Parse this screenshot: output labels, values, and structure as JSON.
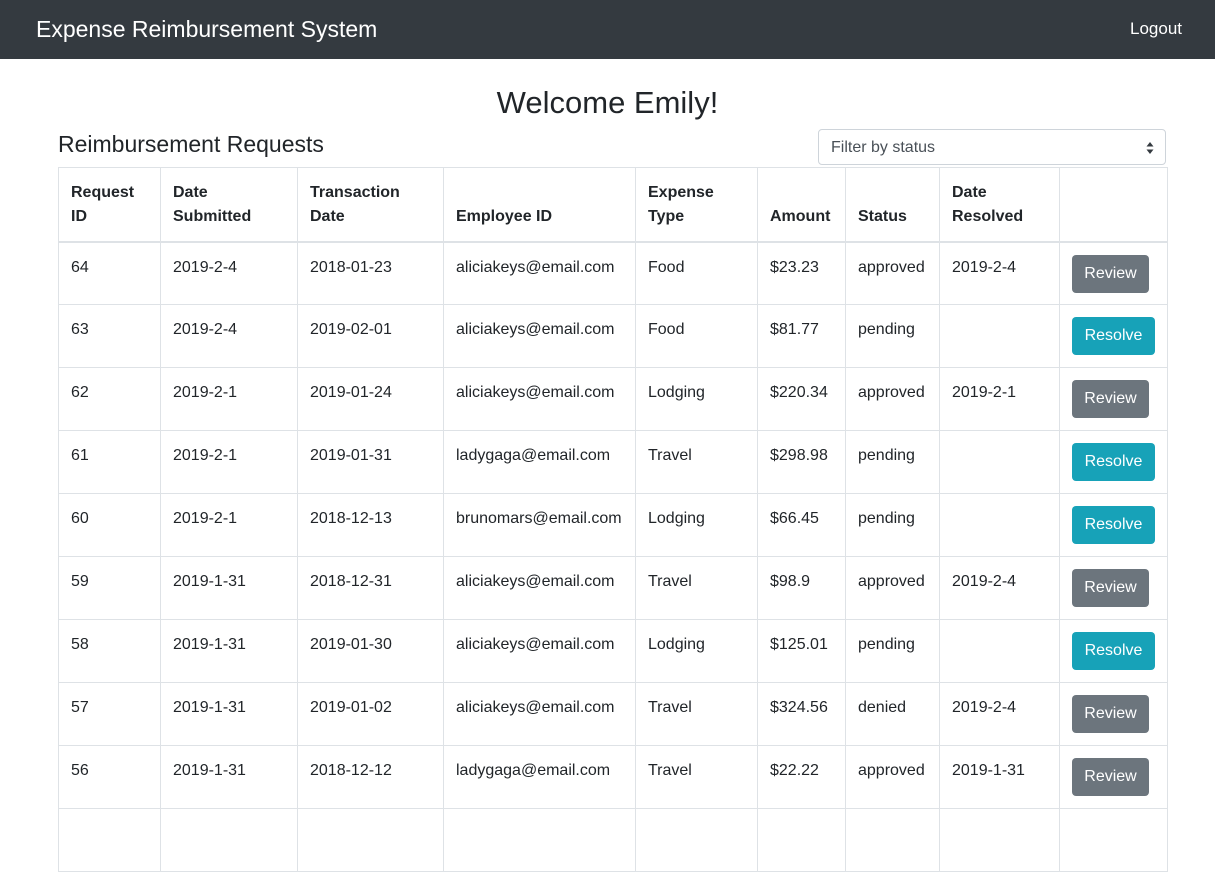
{
  "navbar": {
    "brand": "Expense Reimbursement System",
    "logout_label": "Logout"
  },
  "welcome": "Welcome Emily!",
  "section_title": "Reimbursement Requests",
  "filter": {
    "placeholder": "Filter by status"
  },
  "table": {
    "headers": [
      "Request ID",
      "Date Submitted",
      "Transaction Date",
      "Employee ID",
      "Expense Type",
      "Amount",
      "Status",
      "Date Resolved",
      ""
    ],
    "rows": [
      {
        "id": "64",
        "submitted": "2019-2-4",
        "transaction": "2018-01-23",
        "employee": "aliciakeys@email.com",
        "type": "Food",
        "amount": "$23.23",
        "status": "approved",
        "resolved": "2019-2-4",
        "action": "Review"
      },
      {
        "id": "63",
        "submitted": "2019-2-4",
        "transaction": "2019-02-01",
        "employee": "aliciakeys@email.com",
        "type": "Food",
        "amount": "$81.77",
        "status": "pending",
        "resolved": "",
        "action": "Resolve"
      },
      {
        "id": "62",
        "submitted": "2019-2-1",
        "transaction": "2019-01-24",
        "employee": "aliciakeys@email.com",
        "type": "Lodging",
        "amount": "$220.34",
        "status": "approved",
        "resolved": "2019-2-1",
        "action": "Review"
      },
      {
        "id": "61",
        "submitted": "2019-2-1",
        "transaction": "2019-01-31",
        "employee": "ladygaga@email.com",
        "type": "Travel",
        "amount": "$298.98",
        "status": "pending",
        "resolved": "",
        "action": "Resolve"
      },
      {
        "id": "60",
        "submitted": "2019-2-1",
        "transaction": "2018-12-13",
        "employee": "brunomars@email.com",
        "type": "Lodging",
        "amount": "$66.45",
        "status": "pending",
        "resolved": "",
        "action": "Resolve"
      },
      {
        "id": "59",
        "submitted": "2019-1-31",
        "transaction": "2018-12-31",
        "employee": "aliciakeys@email.com",
        "type": "Travel",
        "amount": "$98.9",
        "status": "approved",
        "resolved": "2019-2-4",
        "action": "Review"
      },
      {
        "id": "58",
        "submitted": "2019-1-31",
        "transaction": "2019-01-30",
        "employee": "aliciakeys@email.com",
        "type": "Lodging",
        "amount": "$125.01",
        "status": "pending",
        "resolved": "",
        "action": "Resolve"
      },
      {
        "id": "57",
        "submitted": "2019-1-31",
        "transaction": "2019-01-02",
        "employee": "aliciakeys@email.com",
        "type": "Travel",
        "amount": "$324.56",
        "status": "denied",
        "resolved": "2019-2-4",
        "action": "Review"
      },
      {
        "id": "56",
        "submitted": "2019-1-31",
        "transaction": "2018-12-12",
        "employee": "ladygaga@email.com",
        "type": "Travel",
        "amount": "$22.22",
        "status": "approved",
        "resolved": "2019-1-31",
        "action": "Review"
      },
      {
        "id": "",
        "submitted": "",
        "transaction": "",
        "employee": "",
        "type": "",
        "amount": "",
        "status": "",
        "resolved": "",
        "action": ""
      }
    ]
  },
  "colors": {
    "navbar_bg": "#343a40",
    "review_button": "#6c757d",
    "resolve_button": "#17a2b8",
    "border": "#dee2e6"
  },
  "icons": {
    "filter_arrow": "select-updown-arrows-icon"
  }
}
